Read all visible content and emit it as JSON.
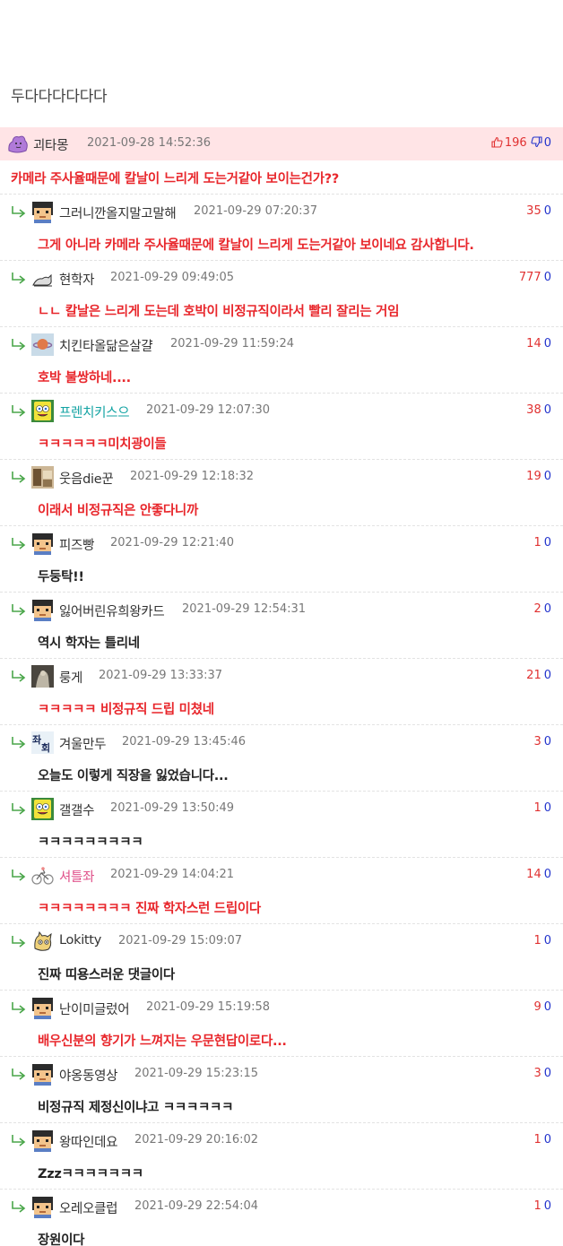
{
  "page_title": "두다다다다다다",
  "top_comment": {
    "nick": "괴타몽",
    "date": "2021-09-28 14:52:36",
    "up": "196",
    "down": "0",
    "text": "카메라 주사율때문에 칼날이 느리게 도는거같아 보이는건가??",
    "avatar": "ditto-avatar"
  },
  "replies": [
    {
      "nick": "그러니깐올지말고말해",
      "date": "2021-09-29 07:20:37",
      "up": "35",
      "down": "0",
      "text": "그게 아니라 카메라 주사율때문에 칼날이 느리게 도는거같아 보이네요 감사합니다.",
      "red": true,
      "avatar": "pixel-avatar",
      "nick_color": "#333333"
    },
    {
      "nick": "현학자",
      "date": "2021-09-29 09:49:05",
      "up": "777",
      "down": "0",
      "text": "ㄴㄴ 칼날은 느리게 도는데 호박이 비정규직이라서 빨리 잘리는 거임",
      "red": true,
      "avatar": "cat-avatar",
      "nick_color": "#333333"
    },
    {
      "nick": "치킨타올닮은살걀",
      "date": "2021-09-29 11:59:24",
      "up": "14",
      "down": "0",
      "text": "호박 불쌍하네....",
      "red": true,
      "avatar": "planet-avatar",
      "nick_color": "#333333"
    },
    {
      "nick": "프렌치키스으",
      "date": "2021-09-29 12:07:30",
      "up": "38",
      "down": "0",
      "text": "ㅋㅋㅋㅋㅋㅋ미치광이들",
      "red": true,
      "avatar": "sponge-avatar",
      "nick_color": "#13a3a3"
    },
    {
      "nick": "웃음die꾼",
      "date": "2021-09-29 12:18:32",
      "up": "19",
      "down": "0",
      "text": "이래서 비정규직은 안좋다니까",
      "red": true,
      "avatar": "photo-avatar",
      "nick_color": "#333333"
    },
    {
      "nick": "피즈빵",
      "date": "2021-09-29 12:21:40",
      "up": "1",
      "down": "0",
      "text": "두둥탁!!",
      "red": false,
      "avatar": "pixel-avatar",
      "nick_color": "#333333"
    },
    {
      "nick": "잃어버린유희왕카드",
      "date": "2021-09-29 12:54:31",
      "up": "2",
      "down": "0",
      "text": "역시 학자는 틀리네",
      "red": false,
      "avatar": "pixel-avatar",
      "nick_color": "#333333"
    },
    {
      "nick": "룽게",
      "date": "2021-09-29 13:33:37",
      "up": "21",
      "down": "0",
      "text": "ㅋㅋㅋㅋㅋ 비정규직 드립 미쳤네",
      "red": true,
      "avatar": "dark-photo-avatar",
      "nick_color": "#333333"
    },
    {
      "nick": "겨울만두",
      "date": "2021-09-29 13:45:46",
      "up": "3",
      "down": "0",
      "text": "오늘도 이렇게 직장을 잃었습니다...",
      "red": false,
      "avatar": "text-avatar",
      "nick_color": "#333333"
    },
    {
      "nick": "갤갤수",
      "date": "2021-09-29 13:50:49",
      "up": "1",
      "down": "0",
      "text": "ㅋㅋㅋㅋㅋㅋㅋㅋㅋ",
      "red": false,
      "avatar": "sponge-avatar",
      "nick_color": "#333333"
    },
    {
      "nick": "셔틀좌",
      "date": "2021-09-29 14:04:21",
      "up": "14",
      "down": "0",
      "text": "ㅋㅋㅋㅋㅋㅋㅋㅋ 진짜 학자스런 드립이다",
      "red": true,
      "avatar": "bike-avatar",
      "nick_color": "#e0508a"
    },
    {
      "nick": "Lokitty",
      "date": "2021-09-29 15:09:07",
      "up": "1",
      "down": "0",
      "text": "진짜 띠용스러운 댓글이다",
      "red": false,
      "avatar": "cat-face-avatar",
      "nick_color": "#333333"
    },
    {
      "nick": "난이미글렀어",
      "date": "2021-09-29 15:19:58",
      "up": "9",
      "down": "0",
      "text": "배우신분의 향기가 느껴지는 우문현답이로다...",
      "red": true,
      "avatar": "pixel-avatar",
      "nick_color": "#333333"
    },
    {
      "nick": "야옹동영상",
      "date": "2021-09-29 15:23:15",
      "up": "3",
      "down": "0",
      "text": "비정규직 제정신이냐고 ㅋㅋㅋㅋㅋㅋ",
      "red": false,
      "avatar": "pixel-avatar",
      "nick_color": "#333333"
    },
    {
      "nick": "왕따인데요",
      "date": "2021-09-29 20:16:02",
      "up": "1",
      "down": "0",
      "text": "Zzzㅋㅋㅋㅋㅋㅋㅋ",
      "red": false,
      "avatar": "pixel-avatar",
      "nick_color": "#333333"
    },
    {
      "nick": "오레오클럽",
      "date": "2021-09-29 22:54:04",
      "up": "1",
      "down": "0",
      "text": "장원이다",
      "red": false,
      "avatar": "pixel-avatar",
      "nick_color": "#333333"
    }
  ],
  "colors": {
    "top_bg": "#ffe4e6",
    "up": "#e03131",
    "down": "#2233cc",
    "red_text": "#e8262b",
    "arrow": "#4aa64a"
  }
}
